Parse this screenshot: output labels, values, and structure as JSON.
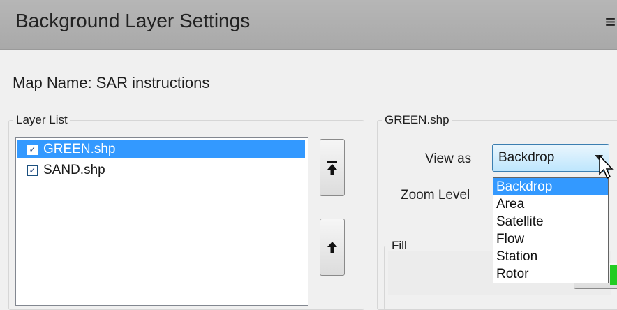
{
  "window": {
    "title": "Background Layer Settings",
    "menu_glyph": "≡"
  },
  "map": {
    "label": "Map Name:",
    "value": "SAR instructions"
  },
  "layer_list": {
    "group_label": "Layer List",
    "items": [
      {
        "label": "GREEN.shp",
        "checked": true,
        "selected": true
      },
      {
        "label": "SAND.shp",
        "checked": true,
        "selected": false
      }
    ],
    "buttons": [
      "move-to-top-icon",
      "move-up-icon"
    ]
  },
  "properties": {
    "group_label": "GREEN.shp",
    "view_as_label": "View as",
    "view_as_value": "Backdrop",
    "view_as_options": [
      "Backdrop",
      "Area",
      "Satellite",
      "Flow",
      "Station",
      "Rotor"
    ],
    "highlighted_option": "Backdrop",
    "zoom_label": "Zoom Level",
    "fill_label": "Fill",
    "fill_color": "#22cc22"
  },
  "colors": {
    "selection": "#3399ff",
    "titlebar": "#b0b0b0"
  }
}
